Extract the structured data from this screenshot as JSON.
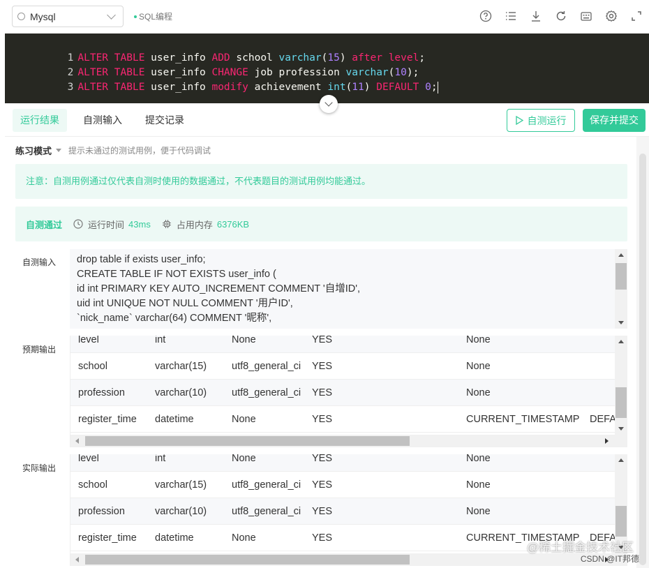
{
  "topbar": {
    "db_select": "Mysql",
    "mode_tag": "SQL编程",
    "icons": [
      "help-icon",
      "list-icon",
      "download-icon",
      "refresh-icon",
      "keyboard-icon",
      "settings-icon",
      "fullscreen-icon"
    ]
  },
  "editor": {
    "lines": [
      {
        "num": "1",
        "tokens": [
          [
            "kw",
            "ALTER"
          ],
          [
            "s",
            " "
          ],
          [
            "kw",
            "TABLE"
          ],
          [
            "s",
            " user_info "
          ],
          [
            "kw",
            "ADD"
          ],
          [
            "s",
            " school "
          ],
          [
            "ty",
            "varchar"
          ],
          [
            "s",
            "("
          ],
          [
            "nm",
            "15"
          ],
          [
            "s",
            ") "
          ],
          [
            "kw",
            "after"
          ],
          [
            "s",
            " "
          ],
          [
            "kw",
            "level"
          ],
          [
            "s",
            ";"
          ]
        ]
      },
      {
        "num": "2",
        "tokens": [
          [
            "kw",
            "ALTER"
          ],
          [
            "s",
            " "
          ],
          [
            "kw",
            "TABLE"
          ],
          [
            "s",
            " user_info "
          ],
          [
            "kw",
            "CHANGE"
          ],
          [
            "s",
            " job profession "
          ],
          [
            "ty",
            "varchar"
          ],
          [
            "s",
            "("
          ],
          [
            "nm",
            "10"
          ],
          [
            "s",
            ");"
          ]
        ]
      },
      {
        "num": "3",
        "tokens": [
          [
            "kw",
            "ALTER"
          ],
          [
            "s",
            " "
          ],
          [
            "kw",
            "TABLE"
          ],
          [
            "s",
            " user_info "
          ],
          [
            "kw",
            "modify"
          ],
          [
            "s",
            " achievement "
          ],
          [
            "ty",
            "int"
          ],
          [
            "s",
            "("
          ],
          [
            "nm",
            "11"
          ],
          [
            "s",
            ") "
          ],
          [
            "kw",
            "DEFAULT"
          ],
          [
            "s",
            " "
          ],
          [
            "nm",
            "0"
          ],
          [
            "s",
            ";"
          ]
        ]
      }
    ]
  },
  "tabs": {
    "result": "运行结果",
    "custom_input": "自测输入",
    "history": "提交记录",
    "run_button": "自测运行",
    "submit_button": "保存并提交"
  },
  "result": {
    "mode_label": "练习模式",
    "mode_hint": "提示未通过的测试用例，便于代码调试",
    "notice": "注意：自测用例通过仅代表自测时使用的数据通过，不代表题目的测试用例均能通过。",
    "status": "自测通过",
    "runtime_label": "运行时间",
    "runtime_value": "43ms",
    "memory_label": "占用内存",
    "memory_value": "6376KB",
    "custom_input_label": "自测输入",
    "expected_label": "预期输出",
    "actual_label": "实际输出",
    "input_lines": [
      "drop table if exists user_info;",
      "CREATE TABLE IF NOT EXISTS user_info (",
      "id int PRIMARY KEY AUTO_INCREMENT COMMENT '自增ID',",
      "uid int UNIQUE NOT NULL COMMENT '用户ID',",
      "`nick_name` varchar(64) COMMENT '昵称',"
    ],
    "expected_rows": [
      [
        "level",
        "int",
        "None",
        "YES",
        "None",
        ""
      ],
      [
        "school",
        "varchar(15)",
        "utf8_general_ci",
        "YES",
        "None",
        ""
      ],
      [
        "profession",
        "varchar(10)",
        "utf8_general_ci",
        "YES",
        "None",
        ""
      ],
      [
        "register_time",
        "datetime",
        "None",
        "YES",
        "CURRENT_TIMESTAMP",
        "DEFA"
      ]
    ],
    "actual_rows": [
      [
        "level",
        "int",
        "None",
        "YES",
        "None",
        ""
      ],
      [
        "school",
        "varchar(15)",
        "utf8_general_ci",
        "YES",
        "None",
        ""
      ],
      [
        "profession",
        "varchar(10)",
        "utf8_general_ci",
        "YES",
        "None",
        ""
      ],
      [
        "register_time",
        "datetime",
        "None",
        "YES",
        "CURRENT_TIMESTAMP",
        "DEFA"
      ]
    ]
  },
  "watermark": {
    "line1": "@稀土掘金技术社区",
    "line2": "CSDN @IT邦德"
  },
  "colors": {
    "accent": "#32ca99",
    "editor_bg": "#272822",
    "keyword": "#f92672",
    "type": "#66d9ef",
    "number": "#ae81ff"
  }
}
